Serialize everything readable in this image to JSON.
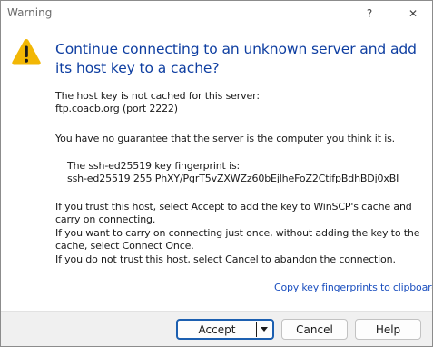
{
  "window": {
    "title": "Warning",
    "help_glyph": "?",
    "close_glyph": "✕"
  },
  "icon": {
    "name": "warning-icon",
    "color": "#f2b705"
  },
  "heading": "Continue connecting to an unknown server and add its host key to a cache?",
  "message": {
    "line1": "The host key is not cached for this server:",
    "line2": "ftp.coacb.org (port 2222)",
    "line3": "You have no guarantee that the server is the computer you think it is.",
    "fingerprint_label": "The ssh-ed25519 key fingerprint is:",
    "fingerprint_value": "ssh-ed25519 255 PhXY/PgrT5vZXWZz60bEjlheFoZ2CtifpBdhBDj0xBI",
    "line4": "If you trust this host, select Accept to add the key to WinSCP's cache and",
    "line5": "carry on connecting.",
    "line6": "If you want to carry on connecting just once, without adding the key to the",
    "line7": "cache, select Connect Once.",
    "line8": "If you do not trust this host, select Cancel to abandon the connection."
  },
  "link": "Copy key fingerprints to clipboard",
  "buttons": {
    "accept": "Accept",
    "cancel": "Cancel",
    "help": "Help"
  },
  "colors": {
    "heading": "#0e3ea1",
    "link": "#1b4fbf",
    "default_button_border": "#1c5fb0"
  }
}
